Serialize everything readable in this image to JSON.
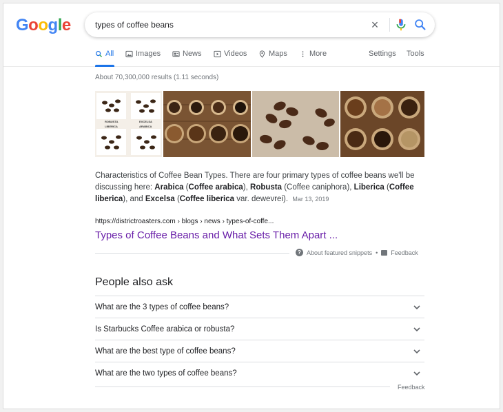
{
  "logo": {
    "letters": [
      "G",
      "o",
      "o",
      "g",
      "l",
      "e"
    ],
    "colors": [
      "#4285f4",
      "#ea4335",
      "#fbbc05",
      "#4285f4",
      "#34a853",
      "#ea4335"
    ]
  },
  "search": {
    "query": "types of coffee beans",
    "clear_icon": "close-icon",
    "mic_icon": "mic-icon",
    "search_icon": "search-icon"
  },
  "tabs": [
    {
      "label": "All",
      "icon": "search-icon"
    },
    {
      "label": "Images",
      "icon": "image-icon"
    },
    {
      "label": "News",
      "icon": "news-icon"
    },
    {
      "label": "Videos",
      "icon": "video-icon"
    },
    {
      "label": "Maps",
      "icon": "map-pin-icon"
    },
    {
      "label": "More",
      "icon": "more-vert-icon"
    }
  ],
  "tools": {
    "settings": "Settings",
    "tools": "Tools"
  },
  "stats": "About 70,300,000 results (1.11 seconds)",
  "images": [
    {
      "name": "coffee-types-chart-image",
      "labels": [
        "ROBUSTA",
        "EXCELSA",
        "LIBERICA",
        "ARABICA"
      ]
    },
    {
      "name": "coffee-bowls-image"
    },
    {
      "name": "coffee-beans-closeup-image"
    },
    {
      "name": "coffee-bowls-grid-image"
    }
  ],
  "snippet": {
    "intro": "Characteristics of Coffee Bean Types. There are four primary types of coffee beans we'll be discussing here: ",
    "arabica": "Arabica",
    "arabica_sci": "Coffee arabica",
    "robusta": "Robusta",
    "robusta_sci": "Coffee caniphora",
    "liberica": "Liberica",
    "liberica_sci": "Coffee liberica",
    "excelsa": "Excelsa",
    "excelsa_sci": "Coffee liberica",
    "excelsa_var": " var. dewevrei",
    "date": "Mar 13, 2019"
  },
  "result": {
    "cite": "https://districtroasters.com › blogs › news › types-of-coffe...",
    "title": "Types of Coffee Beans and What Sets Them Apart ..."
  },
  "featured": {
    "about": "About featured snippets",
    "sep": "•",
    "feedback": "Feedback"
  },
  "paa": {
    "title": "People also ask",
    "questions": [
      "What are the 3 types of coffee beans?",
      "Is Starbucks Coffee arabica or robusta?",
      "What are the best type of coffee beans?",
      "What are the two types of coffee beans?"
    ],
    "feedback": "Feedback"
  }
}
